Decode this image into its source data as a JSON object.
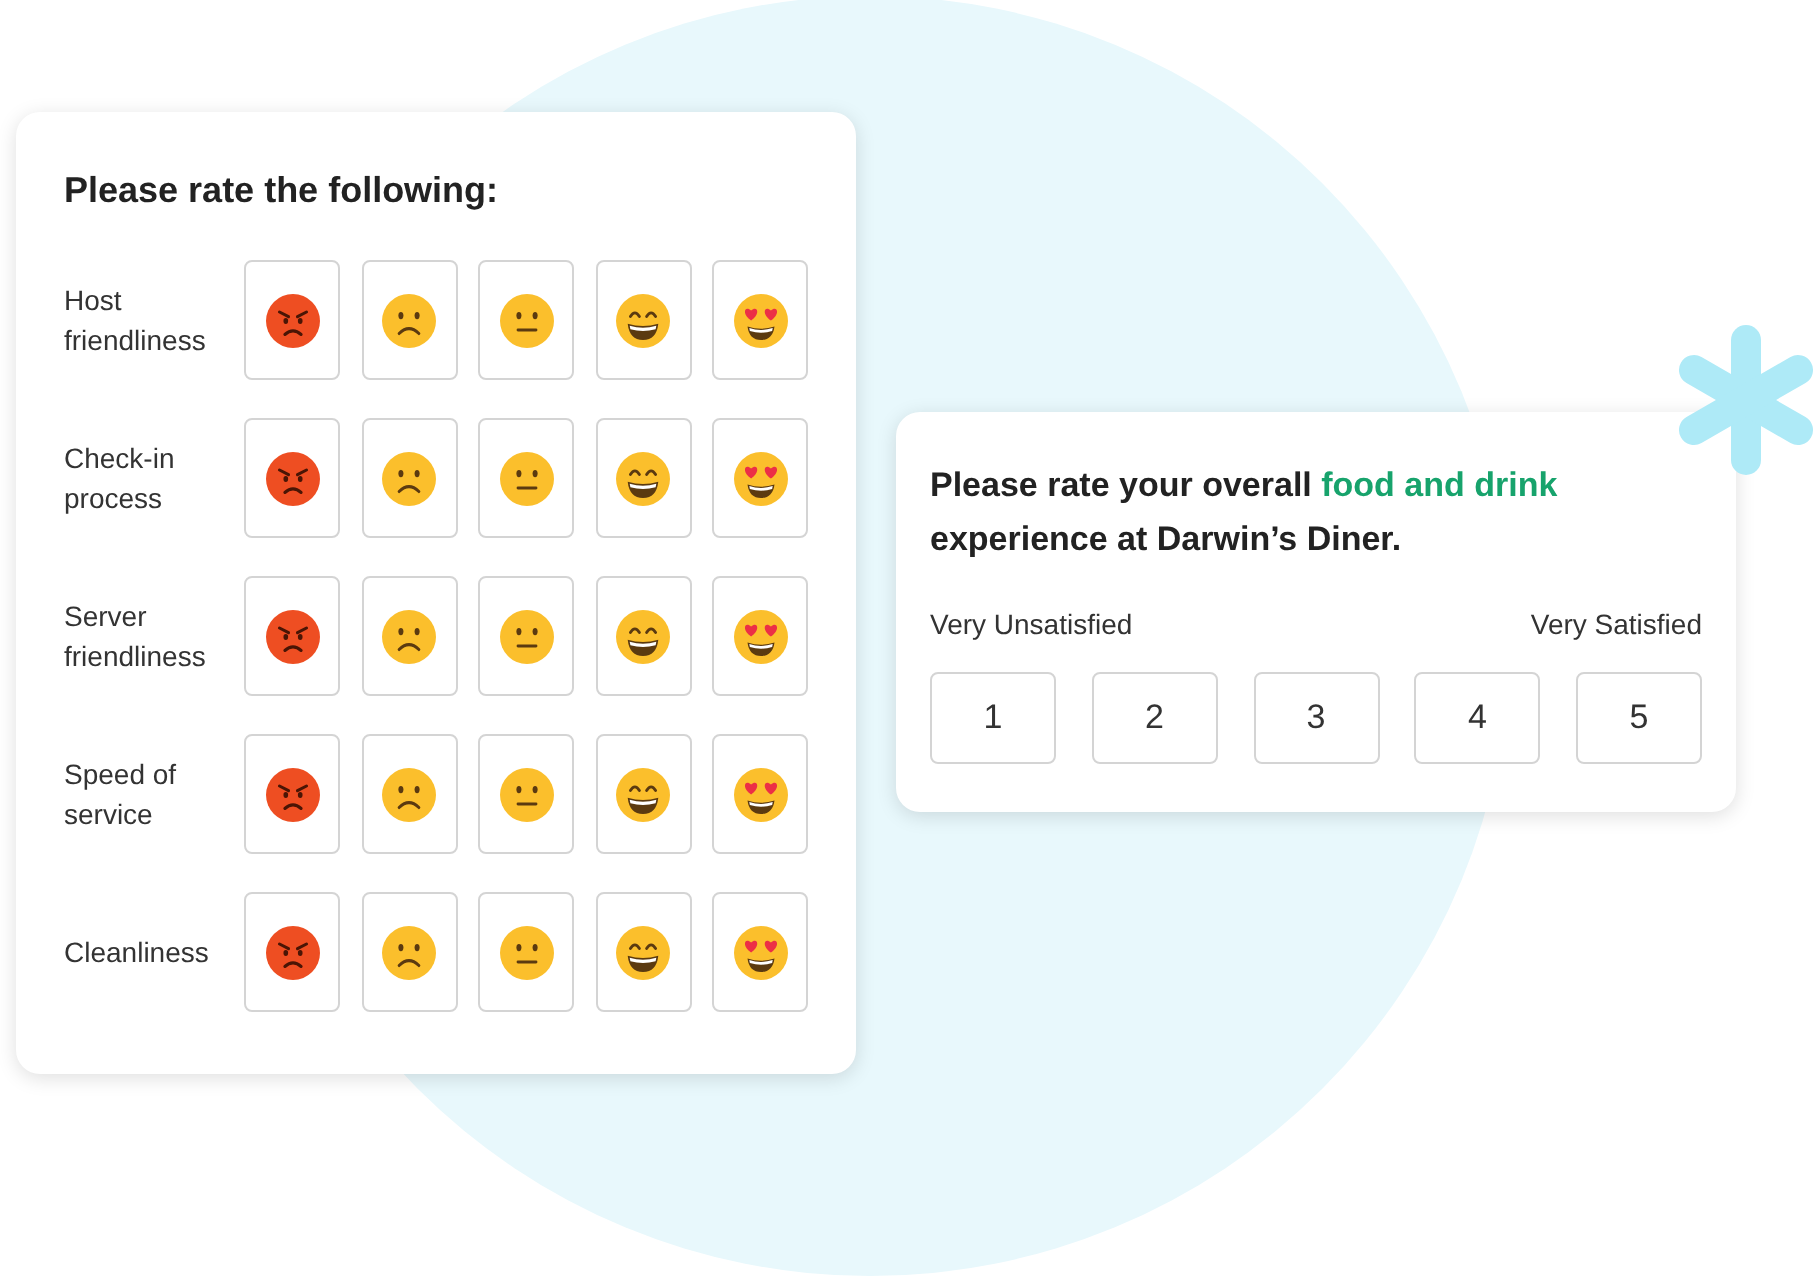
{
  "rating_grid": {
    "title": "Please rate the following:",
    "faces": [
      {
        "kind": "angry"
      },
      {
        "kind": "frowning"
      },
      {
        "kind": "neutral"
      },
      {
        "kind": "grinning"
      },
      {
        "kind": "heart_eyes"
      }
    ],
    "rows": [
      {
        "label": "Host friendliness"
      },
      {
        "label": "Check-in process"
      },
      {
        "label": "Server friendliness"
      },
      {
        "label": "Speed of service"
      },
      {
        "label": "Cleanliness"
      }
    ]
  },
  "overall_rating": {
    "title_parts": [
      {
        "text": "Please rate your overall ",
        "kind": "plain"
      },
      {
        "text": "food and drink",
        "kind": "highlight"
      },
      {
        "text": " experience at Darwin’s Diner.",
        "kind": "plain"
      }
    ],
    "low_label": "Very Unsatisfied",
    "high_label": "Very Satisfied",
    "options": [
      "1",
      "2",
      "3",
      "4",
      "5"
    ]
  }
}
